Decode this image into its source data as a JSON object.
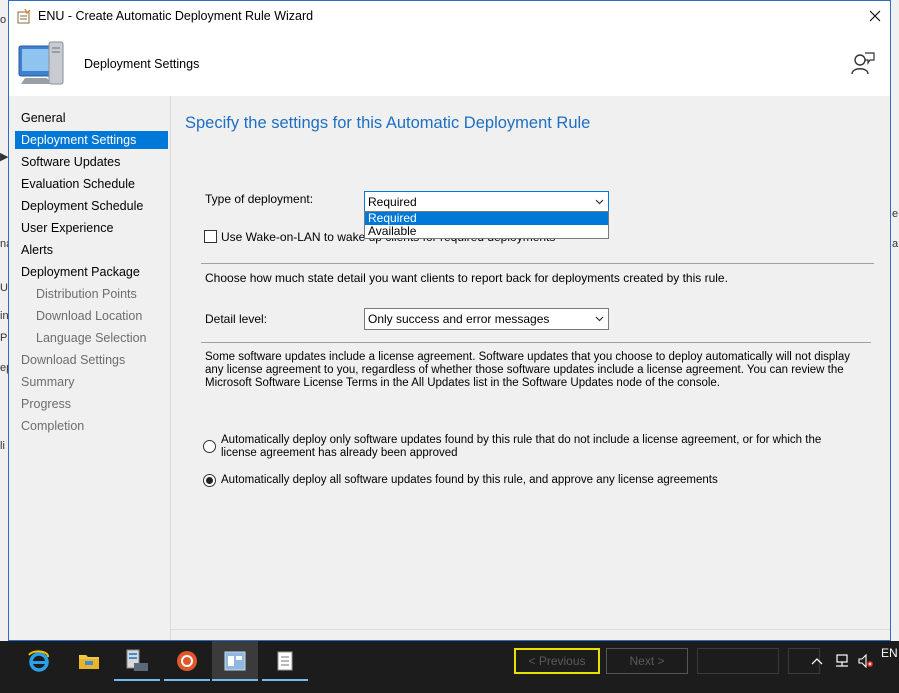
{
  "window": {
    "title": "ENU - Create Automatic Deployment Rule Wizard"
  },
  "header": {
    "title": "Deployment Settings"
  },
  "nav": {
    "items": [
      {
        "label": "General"
      },
      {
        "label": "Deployment Settings"
      },
      {
        "label": "Software Updates"
      },
      {
        "label": "Evaluation Schedule"
      },
      {
        "label": "Deployment Schedule"
      },
      {
        "label": "User Experience"
      },
      {
        "label": "Alerts"
      },
      {
        "label": "Deployment Package"
      },
      {
        "label": "Distribution Points"
      },
      {
        "label": "Download Location"
      },
      {
        "label": "Language Selection"
      },
      {
        "label": "Download Settings"
      },
      {
        "label": "Summary"
      },
      {
        "label": "Progress"
      },
      {
        "label": "Completion"
      }
    ]
  },
  "content": {
    "heading": "Specify the settings for this Automatic Deployment Rule",
    "type_label": "Type of deployment:",
    "type_value": "Required",
    "type_options": [
      "Required",
      "Available"
    ],
    "wol_label": "Use Wake-on-LAN to wake up clients for required deployments",
    "state_text": "Choose how much state detail you want clients to report back for deployments created by this rule.",
    "detail_label": "Detail level:",
    "detail_value": "Only success and error messages",
    "license_text": "Some software updates include a license agreement. Software updates that you choose to deploy automatically will not display any license agreement to you, regardless of whether those software updates include a license agreement. You can review the Microsoft Software License Terms in the All Updates list in the Software Updates node of the console.",
    "radio1_label": "Automatically deploy only software updates found by this rule that do not include a license agreement, or for which the license agreement has already been approved",
    "radio2_label": "Automatically deploy all software updates found by this rule, and approve any license agreements"
  },
  "buttons": {
    "previous": "< Previous",
    "next": "Next >"
  },
  "taskbar": {
    "apps": [
      "internet-explorer",
      "file-explorer",
      "server-manager",
      "app-orange",
      "config-manager-console",
      "wizard-window"
    ],
    "language": "EN"
  },
  "colors": {
    "accent": "#0078d7",
    "heading": "#1e6fc1",
    "taskbar": "#1c1c1c",
    "highlight": "#e8e000"
  }
}
